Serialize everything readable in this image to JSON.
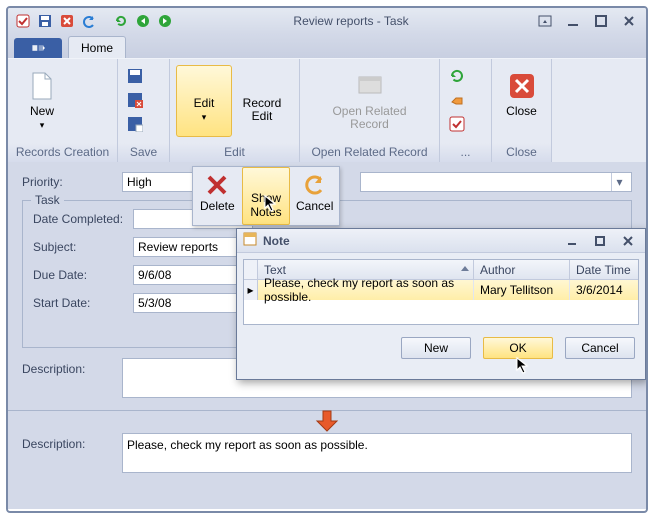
{
  "window": {
    "title": "Review reports - Task"
  },
  "ribbon": {
    "tab_home": "Home",
    "groups": {
      "records_creation": {
        "label": "Records Creation",
        "new": "New"
      },
      "save": {
        "label": "Save"
      },
      "edit": {
        "label": "Edit",
        "edit": "Edit",
        "record_edit": "Record\nEdit"
      },
      "open_related": {
        "label": "Open Related Record",
        "btn": "Open Related\nRecord"
      },
      "misc": {
        "label": "..."
      },
      "close": {
        "label": "Close",
        "btn": "Close"
      }
    }
  },
  "popup": {
    "delete": "Delete",
    "show_notes": "Show Notes",
    "cancel": "Cancel"
  },
  "form": {
    "priority_label": "Priority:",
    "priority_value": "High",
    "task_group_label": "Task",
    "date_completed_label": "Date Completed:",
    "date_completed_value": "",
    "subject_label": "Subject:",
    "subject_value": "Review reports",
    "due_date_label": "Due Date:",
    "due_date_value": "9/6/08",
    "start_date_label": "Start Date:",
    "start_date_value": "5/3/08",
    "description_label": "Description:",
    "description_value": ""
  },
  "note_dialog": {
    "title": "Note",
    "columns": {
      "text": "Text",
      "author": "Author",
      "datetime": "Date Time"
    },
    "rows": [
      {
        "text": "Please, check my report as soon as possible.",
        "author": "Mary Tellitson",
        "datetime": "3/6/2014"
      }
    ],
    "buttons": {
      "new": "New",
      "ok": "OK",
      "cancel": "Cancel"
    }
  },
  "bottom": {
    "description_label": "Description:",
    "description_value": "Please, check my report as soon as possible."
  }
}
